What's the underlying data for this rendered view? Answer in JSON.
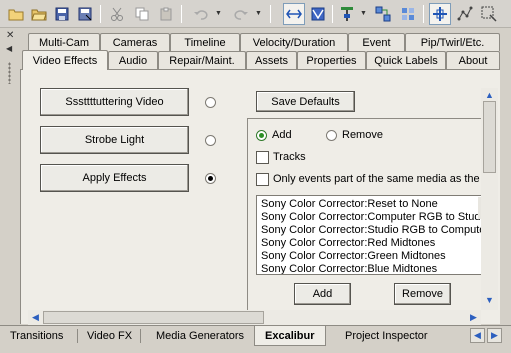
{
  "toolbar": {
    "buttons": [
      "new-folder-icon",
      "open-folder-icon",
      "save-icon",
      "save-as-icon",
      "cut-icon",
      "copy-icon",
      "paste-icon",
      "undo-icon",
      "redo-icon",
      "ripple-edit-icon",
      "envelope-edit-icon",
      "marker-icon",
      "snap-icon",
      "grid-icon",
      "selection-icon",
      "draw-icon",
      "zoom-icon"
    ],
    "accent": "#2055b5"
  },
  "tabs_top_row": [
    "Multi-Cam",
    "Cameras",
    "Timeline",
    "Velocity/Duration",
    "Event",
    "Pip/Twirl/Etc."
  ],
  "tabs_bottom_row": [
    "Video Effects",
    "Audio",
    "Repair/Maint.",
    "Assets",
    "Properties",
    "Quick Labels",
    "About"
  ],
  "active_tab": "Video Effects",
  "effects": {
    "buttons": [
      {
        "label": "Sssttttuttering Video",
        "selected": false
      },
      {
        "label": "Strobe Light",
        "selected": false
      },
      {
        "label": "Apply Effects",
        "selected": true
      }
    ],
    "save_defaults": "Save Defaults",
    "add_label": "Add",
    "remove_label": "Remove",
    "mode_selected": "Add",
    "tracks_label": "Tracks",
    "tracks_checked": false,
    "only_events_label": "Only events part of the same media as the fir",
    "only_events_checked": false,
    "list_items": [
      "Sony Color Corrector:Reset to None",
      "Sony Color Corrector:Computer RGB to Studio",
      "Sony Color Corrector:Studio RGB to Computer",
      "Sony Color Corrector:Red Midtones",
      "Sony Color Corrector:Green Midtones",
      "Sony Color Corrector:Blue Midtones"
    ],
    "add_button": "Add",
    "remove_button": "Remove"
  },
  "bottom_tabs": [
    "Transitions",
    "Video FX",
    "Media Generators",
    "Excalibur",
    "Project Inspector"
  ],
  "bottom_active": "Excalibur"
}
